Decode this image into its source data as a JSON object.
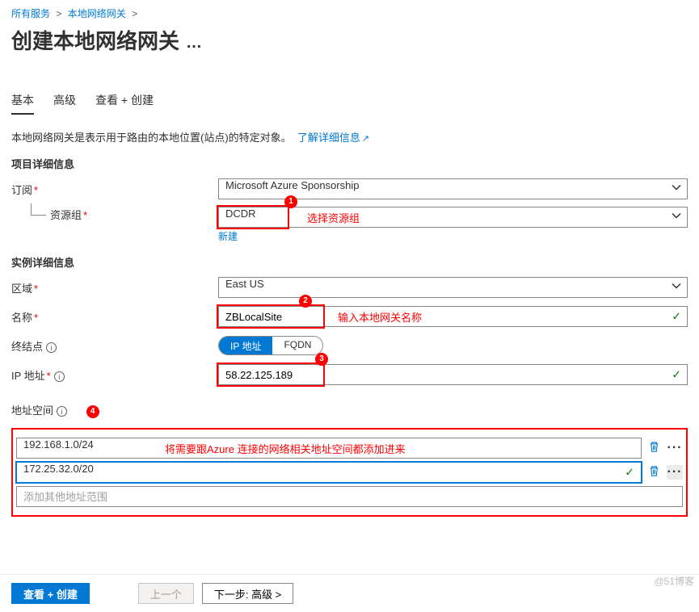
{
  "breadcrumb": {
    "all_services": "所有服务",
    "local_gw": "本地网络网关"
  },
  "title": "创建本地网络网关",
  "tabs": {
    "basic": "基本",
    "advanced": "高级",
    "review": "查看 + 创建"
  },
  "desc": "本地网络网关是表示用于路由的本地位置(站点)的特定对象。",
  "learn_more": "了解详细信息",
  "sections": {
    "project": "项目详细信息",
    "instance": "实例详细信息"
  },
  "labels": {
    "subscription": "订阅",
    "resource_group": "资源组",
    "new": "新建",
    "region": "区域",
    "name": "名称",
    "endpoint": "终结点",
    "ip": "IP 地址",
    "addr_space": "地址空间"
  },
  "values": {
    "subscription": "Microsoft Azure Sponsorship",
    "resource_group": "DCDR",
    "region": "East US",
    "name": "ZBLocalSite",
    "ip": "58.22.125.189",
    "addr1": "192.168.1.0/24",
    "addr2": "172.25.32.0/20",
    "addr_placeholder": "添加其他地址范围"
  },
  "toggle": {
    "ip": "IP 地址",
    "fqdn": "FQDN"
  },
  "annotations": {
    "rg": "选择资源组",
    "name": "输入本地网关名称",
    "addr": "将需要跟Azure 连接的网络相关地址空间都添加进来"
  },
  "footer": {
    "review": "查看 + 创建",
    "prev": "上一个",
    "next": "下一步: 高级 >"
  },
  "watermark": "@51博客"
}
